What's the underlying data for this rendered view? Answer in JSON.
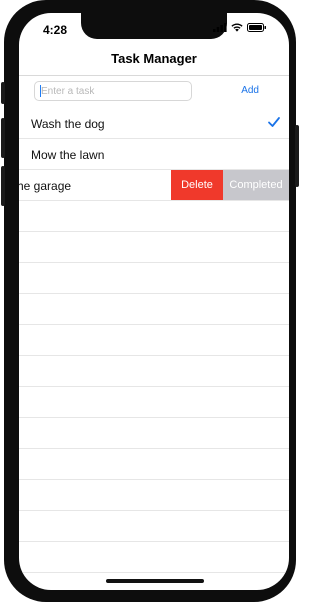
{
  "status_bar": {
    "time": "4:28"
  },
  "nav": {
    "title": "Task Manager"
  },
  "input_row": {
    "placeholder": "Enter a task",
    "value": "",
    "add_label": "Add"
  },
  "tasks": [
    {
      "label": "Wash the dog",
      "completed": true
    },
    {
      "label": "Mow the lawn",
      "completed": false
    },
    {
      "label": "Clean the garage",
      "visible_label": "he garage",
      "completed": false,
      "swiped": true
    }
  ],
  "swipe_actions": {
    "delete_label": "Delete",
    "complete_label": "Completed"
  },
  "colors": {
    "accent": "#1a73e8",
    "delete": "#f0392b",
    "complete": "#c7c7cc"
  }
}
